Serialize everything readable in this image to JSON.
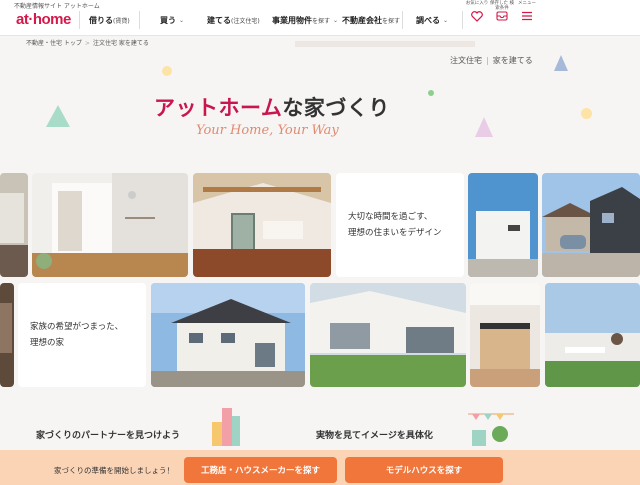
{
  "header": {
    "site_description": "不動産情報サイト アットホーム",
    "logo": "at·home",
    "nav": [
      {
        "label": "借りる",
        "sub": "(賃貸)"
      },
      {
        "label": "買う",
        "sub": ""
      },
      {
        "label": "建てる",
        "sub": "(注文住宅)"
      },
      {
        "label": "事業用物件",
        "sub": "を探す"
      },
      {
        "label": "不動産会社",
        "sub": "を探す"
      },
      {
        "label": "調べる",
        "sub": ""
      }
    ],
    "icons": [
      {
        "name": "favorites",
        "label": "お気に入り"
      },
      {
        "name": "history",
        "label": "保存した 検索条件"
      },
      {
        "name": "menu",
        "label": "メニュー"
      }
    ]
  },
  "breadcrumb": [
    "不動産・住宅 トップ",
    "注文住宅 家を建てる"
  ],
  "tags": [
    "注文住宅",
    "家を建てる"
  ],
  "hero": {
    "title_pink": "アットホーム",
    "title_rest": "な家づくり",
    "subtitle": "Your Home, Your Way"
  },
  "cards": {
    "card1": [
      "大切な時間を過ごす、",
      "理想の住まいをデザイン"
    ],
    "card2": [
      "家族の希望がつまった、",
      "理想の家"
    ]
  },
  "sections": {
    "partner": "家づくりのパートナーを見つけよう",
    "model": "実物を見てイメージを具体化"
  },
  "cta": {
    "lead": "家づくりの準備を開始しましょう！",
    "builder_button": "工務店・ハウスメーカーを探す",
    "model_button": "モデルハウスを探す"
  },
  "colors": {
    "brand": "#d4184a",
    "accent": "#f1763c",
    "cta_bg": "#fbd4b6"
  }
}
